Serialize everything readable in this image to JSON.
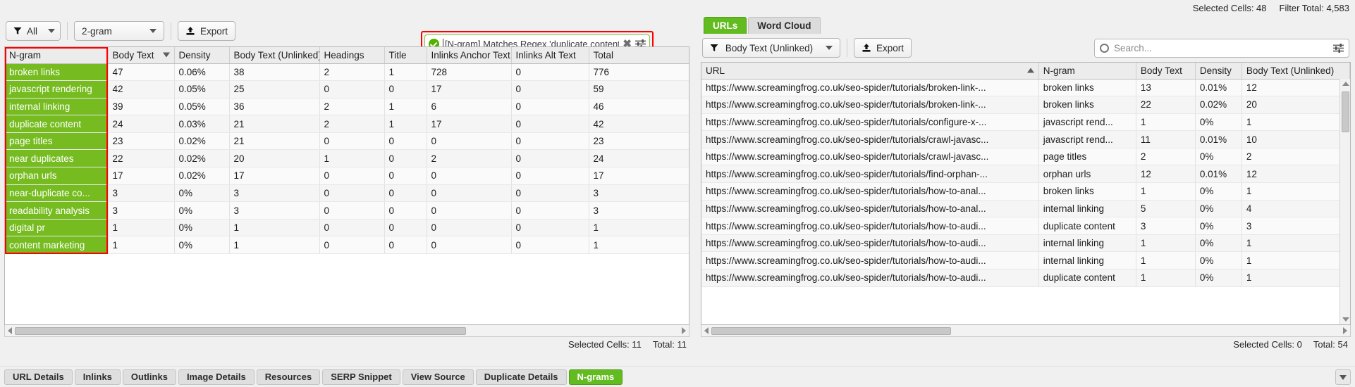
{
  "topbar": {
    "selected_cells": "Selected Cells: 48",
    "filter_total": "Filter Total: 4,583"
  },
  "left_panel": {
    "toolbar": {
      "filter_label": "All",
      "ngram_label": "2-gram",
      "export_label": "Export",
      "filter_icon": "funnel-icon",
      "export_icon": "export-up-arrow-icon"
    },
    "regex_field": {
      "status_icon": "valid-check-icon",
      "value": "[N-gram] Matches Regex 'duplicate content|d",
      "clear_icon": "clear-x-icon",
      "options_icon": "search-options-sliders-icon"
    },
    "table": {
      "columns": [
        "N-gram",
        "Body Text",
        "Density",
        "Body Text (Unlinked)",
        "Headings",
        "Title",
        "Inlinks Anchor Text",
        "Inlinks Alt Text",
        "Total"
      ],
      "sorted_column": "Body Text",
      "sort_direction": "desc",
      "rows": [
        [
          "broken links",
          "47",
          "0.06%",
          "38",
          "2",
          "1",
          "728",
          "0",
          "776"
        ],
        [
          "javascript rendering",
          "42",
          "0.05%",
          "25",
          "0",
          "0",
          "17",
          "0",
          "59"
        ],
        [
          "internal linking",
          "39",
          "0.05%",
          "36",
          "2",
          "1",
          "6",
          "0",
          "46"
        ],
        [
          "duplicate content",
          "24",
          "0.03%",
          "21",
          "2",
          "1",
          "17",
          "0",
          "42"
        ],
        [
          "page titles",
          "23",
          "0.02%",
          "21",
          "0",
          "0",
          "0",
          "0",
          "23"
        ],
        [
          "near duplicates",
          "22",
          "0.02%",
          "20",
          "1",
          "0",
          "2",
          "0",
          "24"
        ],
        [
          "orphan urls",
          "17",
          "0.02%",
          "17",
          "0",
          "0",
          "0",
          "0",
          "17"
        ],
        [
          "near-duplicate co...",
          "3",
          "0%",
          "3",
          "0",
          "0",
          "0",
          "0",
          "3"
        ],
        [
          "readability analysis",
          "3",
          "0%",
          "3",
          "0",
          "0",
          "0",
          "0",
          "3"
        ],
        [
          "digital pr",
          "1",
          "0%",
          "1",
          "0",
          "0",
          "0",
          "0",
          "1"
        ],
        [
          "content marketing",
          "1",
          "0%",
          "1",
          "0",
          "0",
          "0",
          "0",
          "1"
        ]
      ]
    },
    "status": {
      "selected_cells": "Selected Cells: 11",
      "total": "Total: 11"
    }
  },
  "right_panel": {
    "tabs": [
      {
        "label": "URLs",
        "active": true
      },
      {
        "label": "Word Cloud",
        "active": false
      }
    ],
    "toolbar": {
      "filter_label": "Body Text (Unlinked)",
      "export_label": "Export",
      "filter_icon": "funnel-icon",
      "export_icon": "export-up-arrow-icon"
    },
    "search": {
      "placeholder": "Search...",
      "value": "",
      "search_icon": "magnifier-icon",
      "options_icon": "search-options-sliders-icon"
    },
    "table": {
      "columns": [
        "URL",
        "N-gram",
        "Body Text",
        "Density",
        "Body Text (Unlinked)"
      ],
      "sorted_column": "URL",
      "sort_direction": "asc",
      "rows": [
        [
          "https://www.screamingfrog.co.uk/seo-spider/tutorials/broken-link-...",
          "broken links",
          "13",
          "0.01%",
          "12"
        ],
        [
          "https://www.screamingfrog.co.uk/seo-spider/tutorials/broken-link-...",
          "broken links",
          "22",
          "0.02%",
          "20"
        ],
        [
          "https://www.screamingfrog.co.uk/seo-spider/tutorials/configure-x-...",
          "javascript rend...",
          "1",
          "0%",
          "1"
        ],
        [
          "https://www.screamingfrog.co.uk/seo-spider/tutorials/crawl-javasc...",
          "javascript rend...",
          "11",
          "0.01%",
          "10"
        ],
        [
          "https://www.screamingfrog.co.uk/seo-spider/tutorials/crawl-javasc...",
          "page titles",
          "2",
          "0%",
          "2"
        ],
        [
          "https://www.screamingfrog.co.uk/seo-spider/tutorials/find-orphan-...",
          "orphan urls",
          "12",
          "0.01%",
          "12"
        ],
        [
          "https://www.screamingfrog.co.uk/seo-spider/tutorials/how-to-anal...",
          "broken links",
          "1",
          "0%",
          "1"
        ],
        [
          "https://www.screamingfrog.co.uk/seo-spider/tutorials/how-to-anal...",
          "internal linking",
          "5",
          "0%",
          "4"
        ],
        [
          "https://www.screamingfrog.co.uk/seo-spider/tutorials/how-to-audi...",
          "duplicate content",
          "3",
          "0%",
          "3"
        ],
        [
          "https://www.screamingfrog.co.uk/seo-spider/tutorials/how-to-audi...",
          "internal linking",
          "1",
          "0%",
          "1"
        ],
        [
          "https://www.screamingfrog.co.uk/seo-spider/tutorials/how-to-audi...",
          "internal linking",
          "1",
          "0%",
          "1"
        ],
        [
          "https://www.screamingfrog.co.uk/seo-spider/tutorials/how-to-audi...",
          "duplicate content",
          "1",
          "0%",
          "1"
        ]
      ]
    },
    "status": {
      "selected_cells": "Selected Cells: 0",
      "total": "Total: 54"
    }
  },
  "bottom_tabs": [
    {
      "label": "URL Details",
      "active": false
    },
    {
      "label": "Inlinks",
      "active": false
    },
    {
      "label": "Outlinks",
      "active": false
    },
    {
      "label": "Image Details",
      "active": false
    },
    {
      "label": "Resources",
      "active": false
    },
    {
      "label": "SERP Snippet",
      "active": false
    },
    {
      "label": "View Source",
      "active": false
    },
    {
      "label": "Duplicate Details",
      "active": false
    },
    {
      "label": "N-grams",
      "active": true
    }
  ],
  "colors": {
    "accent_green": "#62bb1f",
    "selection_green": "#76bc21",
    "highlight_red": "#ff0000",
    "valid_green": "#56b000"
  }
}
